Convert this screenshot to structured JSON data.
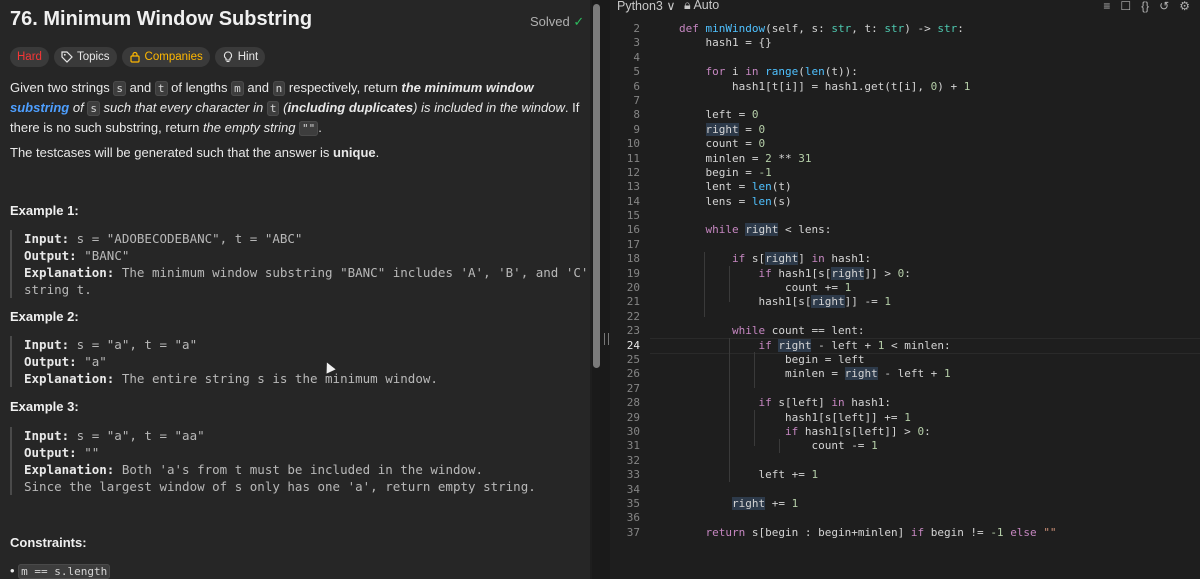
{
  "problem": {
    "title": "76. Minimum Window Substring",
    "solved_label": "Solved",
    "tags": {
      "difficulty": "Hard",
      "topics": "Topics",
      "companies": "Companies",
      "hint": "Hint"
    },
    "desc": {
      "p1_a": "Given two strings ",
      "s": "s",
      "p1_b": " and ",
      "t": "t",
      "p1_c": " of lengths ",
      "m": "m",
      "p1_d": " and ",
      "n": "n",
      "p1_e": " respectively, return ",
      "p1_f": "the ",
      "p1_g": "minimum window",
      "p1_h": "substring",
      "p1_i": " of ",
      "p1_j": " such that every character in ",
      "p1_k": " (",
      "p1_l": "including duplicates",
      "p1_m": ") is included in the window",
      "p1_n": ". If there is no such substring, return ",
      "p1_o": "the empty string ",
      "empty": "\"\"",
      "p1_p": ".",
      "p2_a": "The testcases will be generated such that the answer is ",
      "p2_b": "unique",
      "p2_c": "."
    },
    "examples": [
      {
        "heading": "Example 1:",
        "input_label": "Input:",
        "input": " s = \"ADOBECODEBANC\", t = \"ABC\"",
        "output_label": "Output:",
        "output": " \"BANC\"",
        "expl_label": "Explanation:",
        "expl": " The minimum window substring \"BANC\" includes 'A', 'B', and 'C' from",
        "expl2": "string t."
      },
      {
        "heading": "Example 2:",
        "input_label": "Input:",
        "input": " s = \"a\", t = \"a\"",
        "output_label": "Output:",
        "output": " \"a\"",
        "expl_label": "Explanation:",
        "expl": " The entire string s is the minimum window."
      },
      {
        "heading": "Example 3:",
        "input_label": "Input:",
        "input": " s = \"a\", t = \"aa\"",
        "output_label": "Output:",
        "output": " \"\"",
        "expl_label": "Explanation:",
        "expl": " Both 'a's from t must be included in the window.",
        "expl2": "Since the largest window of s only has one 'a', return empty string."
      }
    ],
    "constraints_heading": "Constraints:",
    "constraint1": "m == s.length"
  },
  "editor": {
    "language": "Python3",
    "mode": "Auto",
    "current_line": "24",
    "line_numbers": [
      "2",
      "3",
      "4",
      "5",
      "6",
      "7",
      "8",
      "9",
      "10",
      "11",
      "12",
      "13",
      "14",
      "15",
      "16",
      "17",
      "18",
      "19",
      "20",
      "21",
      "22",
      "23",
      "24",
      "25",
      "26",
      "27",
      "28",
      "29",
      "30",
      "31",
      "32",
      "33",
      "34",
      "35",
      "36",
      "37"
    ],
    "code": {
      "l2_def": "def",
      "l2_fn": "minWindow",
      "l2_rest": "(self, s: ",
      "l2_str1": "str",
      "l2_m": ", t: ",
      "l2_str2": "str",
      "l2_arrow": ") -> ",
      "l2_str3": "str",
      "l2_colon": ":",
      "l3": "    hash1 = {}",
      "l5_for": "for",
      "l5_i": " i ",
      "l5_in": "in",
      "l5_range": " range",
      "l5_a": "(",
      "l5_len": "len",
      "l5_b": "(t)):",
      "l6_a": "hash1[t[i]] = hash1.get(t[i], ",
      "l6_0": "0",
      "l6_b": ") + ",
      "l6_1": "1",
      "l8_a": "left = ",
      "l8_n": "0",
      "l9_a": "right",
      "l9_b": " = ",
      "l9_n": "0",
      "l10_a": "count = ",
      "l10_n": "0",
      "l11_a": "minlen = ",
      "l11_n1": "2",
      "l11_b": " ** ",
      "l11_n2": "31",
      "l12_a": "begin = ",
      "l12_n": "-1",
      "l13_a": "lent = ",
      "l13_len": "len",
      "l13_b": "(t)",
      "l14_a": "lens = ",
      "l14_len": "len",
      "l14_b": "(s)",
      "l16_while": "while",
      "l16_sp": " ",
      "l16_right": "right",
      "l16_b": " < lens:",
      "l18_if": "if",
      "l18_a": " s[",
      "l18_right": "right",
      "l18_b": "] ",
      "l18_in": "in",
      "l18_c": " hash1:",
      "l19_if": "if",
      "l19_a": " hash1[s[",
      "l19_right": "right",
      "l19_b": "]] > ",
      "l19_n": "0",
      "l19_c": ":",
      "l20_a": "count += ",
      "l20_n": "1",
      "l21_a": "hash1[s[",
      "l21_right": "right",
      "l21_b": "]] -= ",
      "l21_n": "1",
      "l23_while": "while",
      "l23_a": " count == lent:",
      "l24_if": "if",
      "l24_sp": " ",
      "l24_right": "right",
      "l24_a": " - left + ",
      "l24_n": "1",
      "l24_b": " < minlen:",
      "l25_a": "begin = left",
      "l26_a": "minlen = ",
      "l26_right": "right",
      "l26_b": " - left + ",
      "l26_n": "1",
      "l28_if": "if",
      "l28_a": " s[left] ",
      "l28_in": "in",
      "l28_b": " hash1:",
      "l29_a": "hash1[s[left]] += ",
      "l29_n": "1",
      "l30_if": "if",
      "l30_a": " hash1[s[left]] > ",
      "l30_n": "0",
      "l30_b": ":",
      "l31_a": "count -= ",
      "l31_n": "1",
      "l33_a": "left += ",
      "l33_n": "1",
      "l35_right": "right",
      "l35_a": " += ",
      "l35_n": "1",
      "l37_return": "return",
      "l37_a": " s[begin : begin+minlen] ",
      "l37_if": "if",
      "l37_b": " begin != ",
      "l37_n": "-1",
      "l37_sp": " ",
      "l37_else": "else",
      "l37_sp2": " ",
      "l37_str": "\"\""
    }
  }
}
